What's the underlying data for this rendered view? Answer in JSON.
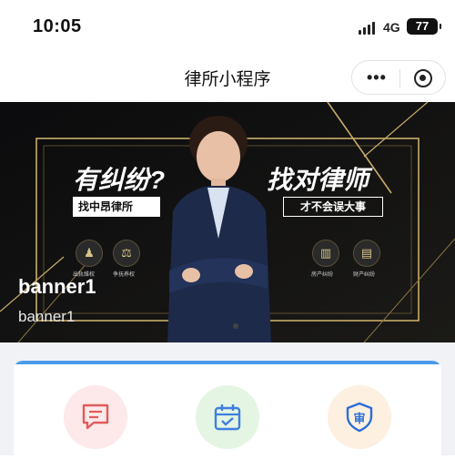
{
  "status_bar": {
    "time": "10:05",
    "network": "4G",
    "battery": "77"
  },
  "navbar": {
    "title": "律所小程序",
    "more_icon": "more-dots-icon",
    "close_icon": "target-circle-icon"
  },
  "banner": {
    "slogan_left": "有纠纷?",
    "slogan_right": "找对律师",
    "tag_left": "找中昂律所",
    "tag_right": "才不会误大事",
    "left_icons": [
      {
        "label": "出轨维权",
        "icon": "person-icon"
      },
      {
        "label": "争抚养权",
        "icon": "scale-icon"
      }
    ],
    "right_icons": [
      {
        "label": "房产纠纷",
        "icon": "building-icon"
      },
      {
        "label": "财产纠纷",
        "icon": "document-icon"
      }
    ],
    "caption_title": "banner1",
    "caption_subtitle": "banner1"
  },
  "quick_actions": [
    {
      "icon": "chat-icon",
      "color": "#e35b5b",
      "bg": "#fde9ea"
    },
    {
      "icon": "calendar-check-icon",
      "color": "#3f7fe0",
      "bg": "#e4f5e4"
    },
    {
      "icon": "shield-trial-icon",
      "color": "#2a6fd8",
      "bg": "#fdf0e0"
    }
  ],
  "colors": {
    "accent_blue": "#4a9be8",
    "banner_gold": "#c9ad6a",
    "page_bg": "#f1f2f6"
  }
}
